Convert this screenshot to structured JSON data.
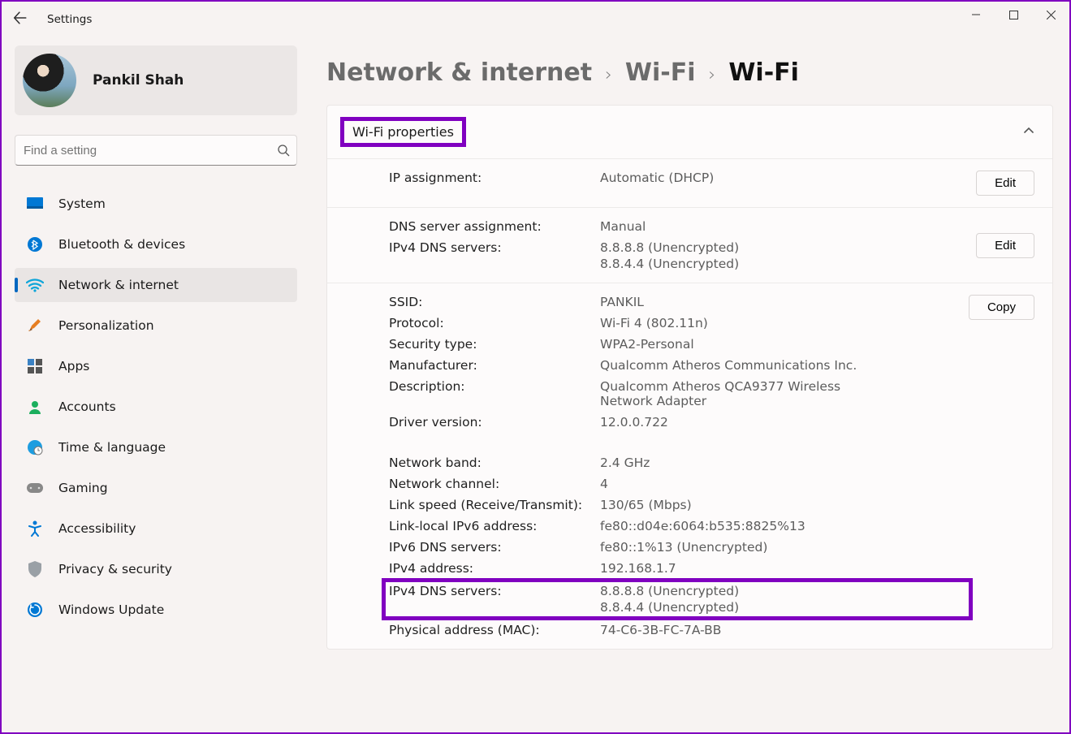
{
  "window": {
    "title": "Settings"
  },
  "profile": {
    "name": "Pankil Shah"
  },
  "search": {
    "placeholder": "Find a setting"
  },
  "nav": {
    "items": [
      {
        "label": "System"
      },
      {
        "label": "Bluetooth & devices"
      },
      {
        "label": "Network & internet"
      },
      {
        "label": "Personalization"
      },
      {
        "label": "Apps"
      },
      {
        "label": "Accounts"
      },
      {
        "label": "Time & language"
      },
      {
        "label": "Gaming"
      },
      {
        "label": "Accessibility"
      },
      {
        "label": "Privacy & security"
      },
      {
        "label": "Windows Update"
      }
    ]
  },
  "breadcrumb": {
    "a": "Network & internet",
    "b": "Wi-Fi",
    "current": "Wi-Fi"
  },
  "section": {
    "title": "Wi-Fi properties",
    "edit": "Edit",
    "copy": "Copy"
  },
  "props": {
    "ip_assignment": {
      "k": "IP assignment:",
      "v": "Automatic (DHCP)"
    },
    "dns_assignment": {
      "k": "DNS server assignment:",
      "v": "Manual"
    },
    "ipv4_dns": {
      "k": "IPv4 DNS servers:",
      "v1": "8.8.8.8 (Unencrypted)",
      "v2": "8.8.4.4 (Unencrypted)"
    },
    "ssid": {
      "k": "SSID:",
      "v": "PANKIL"
    },
    "protocol": {
      "k": "Protocol:",
      "v": "Wi-Fi 4 (802.11n)"
    },
    "security": {
      "k": "Security type:",
      "v": "WPA2-Personal"
    },
    "manufacturer": {
      "k": "Manufacturer:",
      "v": "Qualcomm Atheros Communications Inc."
    },
    "description": {
      "k": "Description:",
      "v": "Qualcomm Atheros QCA9377 Wireless Network Adapter"
    },
    "driver": {
      "k": "Driver version:",
      "v": "12.0.0.722"
    },
    "band": {
      "k": "Network band:",
      "v": "2.4 GHz"
    },
    "channel": {
      "k": "Network channel:",
      "v": "4"
    },
    "link_speed": {
      "k": "Link speed (Receive/Transmit):",
      "v": "130/65 (Mbps)"
    },
    "ll_ipv6": {
      "k": "Link-local IPv6 address:",
      "v": "fe80::d04e:6064:b535:8825%13"
    },
    "ipv6_dns": {
      "k": "IPv6 DNS servers:",
      "v": "fe80::1%13 (Unencrypted)"
    },
    "ipv4_addr": {
      "k": "IPv4 address:",
      "v": "192.168.1.7"
    },
    "ipv4_dns2": {
      "k": "IPv4 DNS servers:",
      "v1": "8.8.8.8 (Unencrypted)",
      "v2": "8.8.4.4 (Unencrypted)"
    },
    "mac": {
      "k": "Physical address (MAC):",
      "v": "74-C6-3B-FC-7A-BB"
    }
  }
}
